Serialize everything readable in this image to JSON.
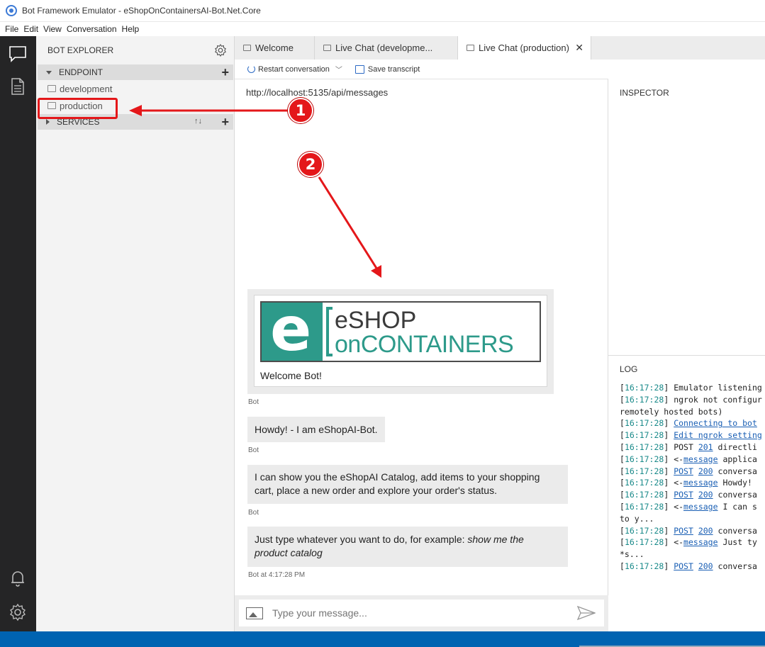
{
  "window": {
    "title": "Bot Framework Emulator - eShopOnContainersAI-Bot.Net.Core"
  },
  "menu": [
    "File",
    "Edit",
    "View",
    "Conversation",
    "Help"
  ],
  "activity_icons": [
    "chat-icon",
    "document-icon",
    "bell-icon",
    "gear-icon"
  ],
  "explorer": {
    "title": "BOT EXPLORER",
    "endpoint_section": "ENDPOINT",
    "endpoints": [
      "development",
      "production"
    ],
    "services_section": "SERVICES"
  },
  "tabs": [
    {
      "label": "Welcome",
      "active": false
    },
    {
      "label": "Live Chat (developme...",
      "active": false
    },
    {
      "label": "Live Chat (production)",
      "active": true
    }
  ],
  "toolbar": {
    "restart_label": "Restart conversation",
    "save_label": "Save transcript"
  },
  "chat": {
    "url": "http://localhost:5135/api/messages",
    "card": {
      "logo_line1": "eSHOP",
      "logo_line2": "onCONTAINERS",
      "logo_letter": "e",
      "text": "Welcome Bot!"
    },
    "messages": [
      {
        "meta": "Bot"
      },
      {
        "text": "Howdy! - I am eShopAI-Bot.",
        "meta": "Bot"
      },
      {
        "line1": "I can show you the eShopAI Catalog, add items to your shopping",
        "line2": "cart, place a new order and explore your order's status.",
        "meta": "Bot"
      },
      {
        "line1_plain": "Just type whatever you want to do, for example: ",
        "line1_italic": "show me the",
        "line2_italic": "product catalog",
        "meta": "Bot at 4:17:28 PM"
      }
    ],
    "input_placeholder": "Type your message..."
  },
  "inspector": {
    "label": "INSPECTOR"
  },
  "log": {
    "label": "LOG",
    "lines": [
      {
        "ts": "16:17:28",
        "pre": "Emulator listening",
        "link": "",
        "post": ""
      },
      {
        "ts": "16:17:28",
        "pre": "ngrok not configur",
        "link": "",
        "post": ""
      },
      {
        "ts": "",
        "pre": "remotely hosted bots)",
        "link": "",
        "post": ""
      },
      {
        "ts": "16:17:28",
        "pre": "",
        "link": "Connecting to bot",
        "post": ""
      },
      {
        "ts": "16:17:28",
        "pre": "",
        "link": "Edit ngrok setting",
        "post": ""
      },
      {
        "ts": "16:17:28",
        "pre": "POST ",
        "link": "201",
        "post": " directli"
      },
      {
        "ts": "16:17:28",
        "pre": "<-",
        "link": "message",
        "post": " applica"
      },
      {
        "ts": "16:17:28",
        "pre": "",
        "link": "POST",
        "post": " ",
        "link2": "200",
        "post2": " conversa"
      },
      {
        "ts": "16:17:28",
        "pre": "<-",
        "link": "message",
        "post": " Howdy!"
      },
      {
        "ts": "16:17:28",
        "pre": "",
        "link": "POST",
        "post": " ",
        "link2": "200",
        "post2": " conversa"
      },
      {
        "ts": "16:17:28",
        "pre": "<-",
        "link": "message",
        "post": " I can s"
      },
      {
        "ts": "",
        "pre": "to y...",
        "link": "",
        "post": ""
      },
      {
        "ts": "16:17:28",
        "pre": "",
        "link": "POST",
        "post": " ",
        "link2": "200",
        "post2": " conversa"
      },
      {
        "ts": "16:17:28",
        "pre": "<-",
        "link": "message",
        "post": " Just ty"
      },
      {
        "ts": "",
        "pre": "*s...",
        "link": "",
        "post": ""
      },
      {
        "ts": "16:17:28",
        "pre": "",
        "link": "POST",
        "post": " ",
        "link2": "200",
        "post2": " conversa"
      }
    ]
  },
  "annotations": {
    "badge1": "1",
    "badge2": "2",
    "color": "#e4171a"
  },
  "colors": {
    "activity_bg": "#252526",
    "status_bar": "#0063b1",
    "accent": "#2c6ac4",
    "brand_teal": "#2d9a8a"
  }
}
